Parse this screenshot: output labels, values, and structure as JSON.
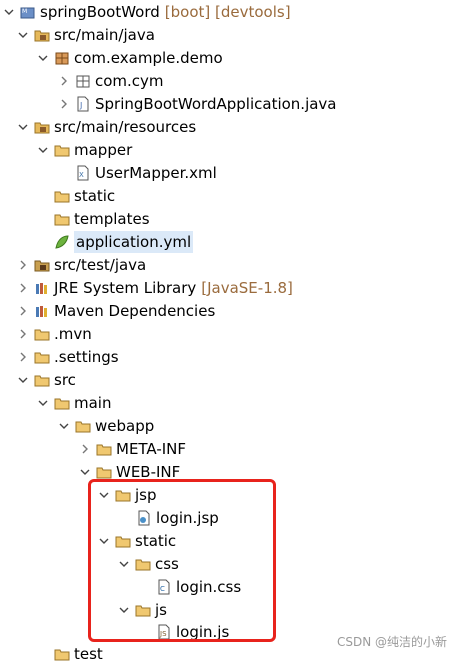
{
  "tree": [
    {
      "id": "project",
      "label": "springBootWord",
      "deco": "[boot] [devtools]",
      "icon": "maven-project-icon",
      "twisty": "down"
    },
    {
      "id": "src-main-java",
      "label": "src/main/java",
      "icon": "source-folder-icon",
      "twisty": "down"
    },
    {
      "id": "com-example-demo",
      "label": "com.example.demo",
      "icon": "package-icon",
      "twisty": "down"
    },
    {
      "id": "com-cym",
      "label": "com.cym",
      "icon": "empty-package-icon",
      "twisty": "right"
    },
    {
      "id": "app-java",
      "label": "SpringBootWordApplication.java",
      "icon": "java-file-icon",
      "twisty": "right"
    },
    {
      "id": "src-main-resources",
      "label": "src/main/resources",
      "icon": "source-folder-icon",
      "twisty": "down"
    },
    {
      "id": "mapper",
      "label": "mapper",
      "icon": "folder-open-icon",
      "twisty": "down"
    },
    {
      "id": "usermapper-xml",
      "label": "UserMapper.xml",
      "icon": "xml-file-icon",
      "twisty": "none"
    },
    {
      "id": "static-res",
      "label": "static",
      "icon": "folder-icon",
      "twisty": "none"
    },
    {
      "id": "templates",
      "label": "templates",
      "icon": "folder-icon",
      "twisty": "none"
    },
    {
      "id": "application-yml",
      "label": "application.yml",
      "icon": "spring-yml-icon",
      "twisty": "none",
      "selected": true
    },
    {
      "id": "src-test-java",
      "label": "src/test/java",
      "icon": "source-folder-icon",
      "twisty": "right"
    },
    {
      "id": "jre",
      "label": "JRE System Library",
      "deco": "[JavaSE-1.8]",
      "icon": "library-icon",
      "twisty": "right"
    },
    {
      "id": "maven-deps",
      "label": "Maven Dependencies",
      "icon": "library-icon",
      "twisty": "right"
    },
    {
      "id": "mvn",
      "label": ".mvn",
      "icon": "folder-icon",
      "twisty": "right"
    },
    {
      "id": "settings",
      "label": ".settings",
      "icon": "folder-icon",
      "twisty": "right"
    },
    {
      "id": "src",
      "label": "src",
      "icon": "folder-open-icon",
      "twisty": "down"
    },
    {
      "id": "main",
      "label": "main",
      "icon": "folder-open-icon",
      "twisty": "down"
    },
    {
      "id": "webapp",
      "label": "webapp",
      "icon": "folder-open-icon",
      "twisty": "down"
    },
    {
      "id": "meta-inf",
      "label": "META-INF",
      "icon": "folder-icon",
      "twisty": "right"
    },
    {
      "id": "web-inf",
      "label": "WEB-INF",
      "icon": "folder-open-icon",
      "twisty": "down"
    },
    {
      "id": "jsp",
      "label": "jsp",
      "icon": "folder-open-icon",
      "twisty": "down"
    },
    {
      "id": "login-jsp",
      "label": "login.jsp",
      "icon": "jsp-file-icon",
      "twisty": "none"
    },
    {
      "id": "static",
      "label": "static",
      "icon": "folder-open-icon",
      "twisty": "down"
    },
    {
      "id": "css",
      "label": "css",
      "icon": "folder-open-icon",
      "twisty": "down"
    },
    {
      "id": "login-css",
      "label": "login.css",
      "icon": "css-file-icon",
      "twisty": "none"
    },
    {
      "id": "js",
      "label": "js",
      "icon": "folder-open-icon",
      "twisty": "down"
    },
    {
      "id": "login-js",
      "label": "login.js",
      "icon": "js-file-icon",
      "twisty": "none"
    },
    {
      "id": "test",
      "label": "test",
      "icon": "folder-icon",
      "twisty": "none"
    }
  ],
  "watermark": "CSDN @纯洁的小新",
  "colors": {
    "highlight_box": "#e8231c",
    "selection": "#dbe9f8",
    "decoration": "#9a6b3d"
  }
}
